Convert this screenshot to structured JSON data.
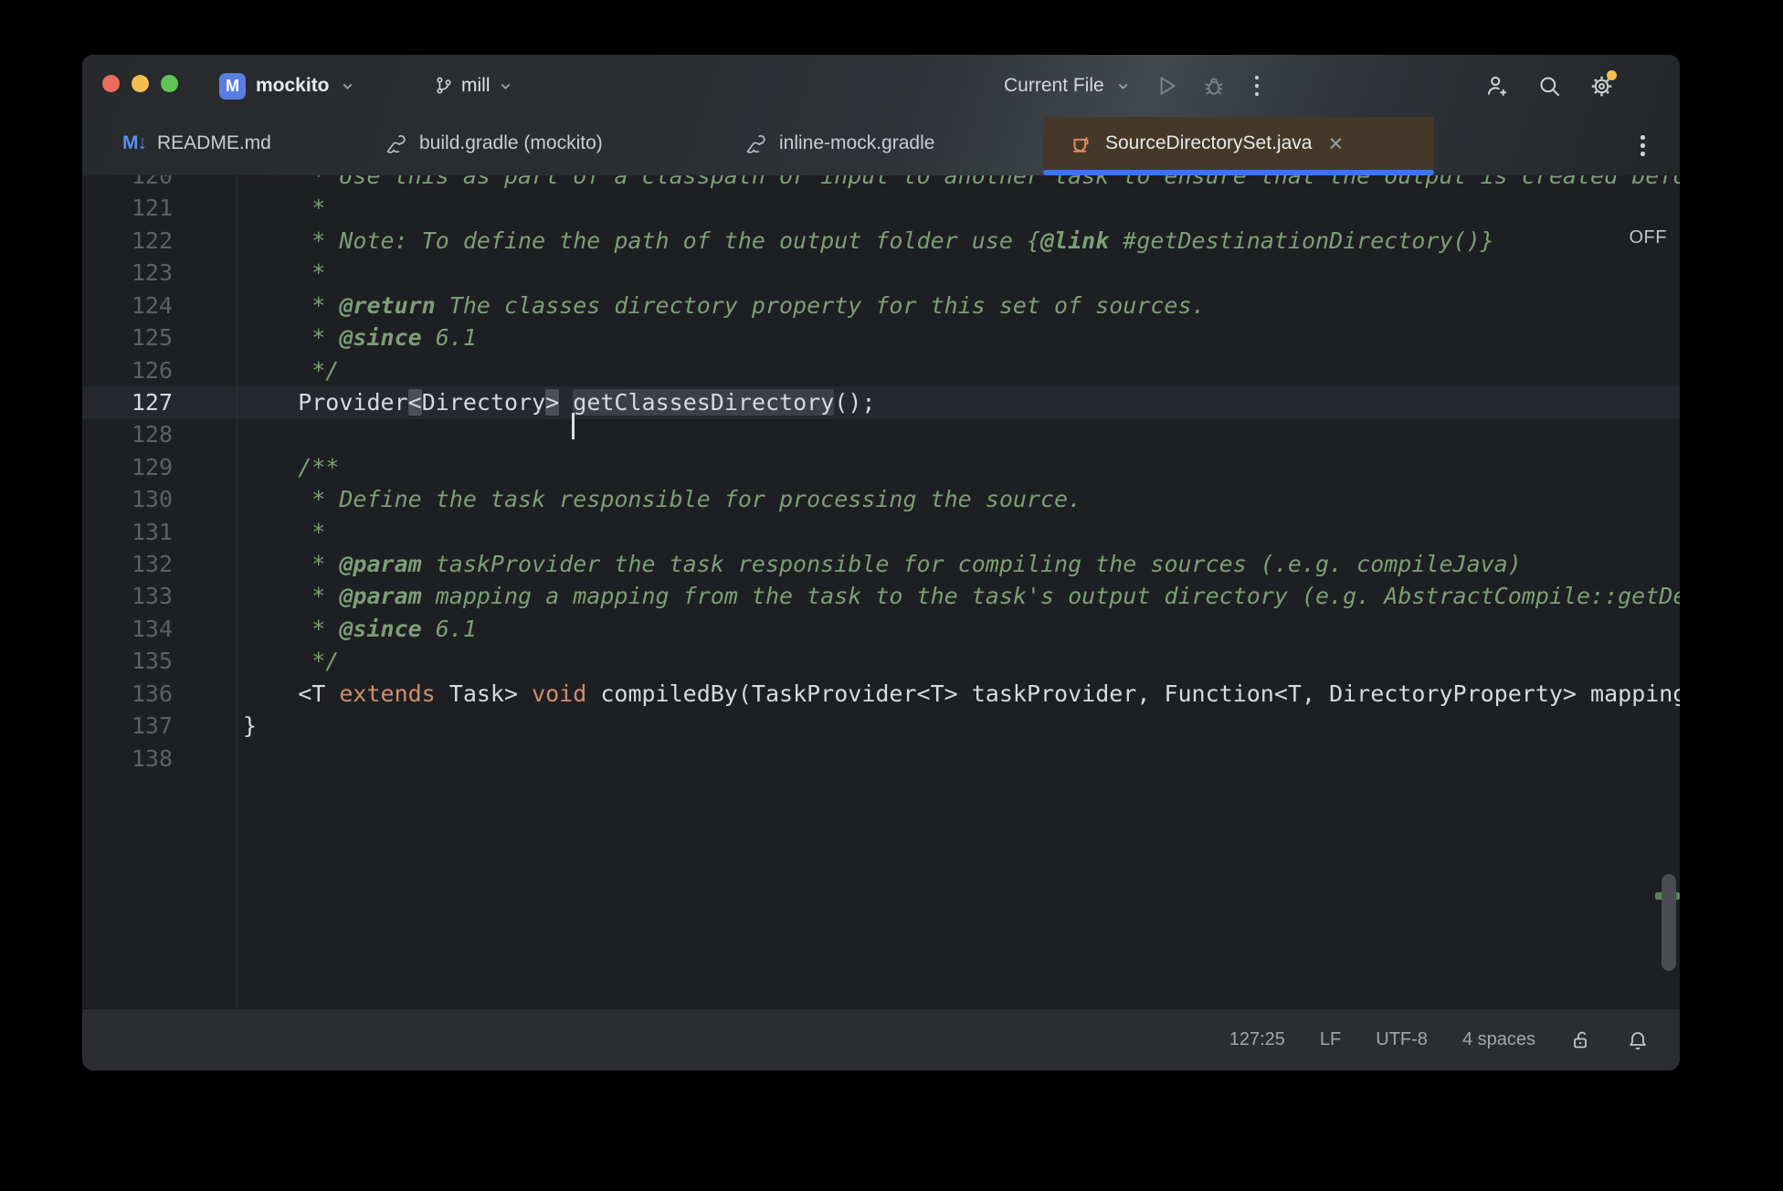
{
  "titlebar": {
    "project_icon_letter": "M",
    "project_name": "mockito",
    "branch_name": "mill",
    "run_config": "Current File"
  },
  "tabs": [
    {
      "label": "README.md",
      "icon": "markdown"
    },
    {
      "label": "build.gradle (mockito)",
      "icon": "gradle"
    },
    {
      "label": "inline-mock.gradle",
      "icon": "gradle"
    },
    {
      "label": "SourceDirectorySet.java",
      "icon": "java",
      "close_glyph": "×",
      "active": true
    }
  ],
  "markdown_glyph": "M↓",
  "editor": {
    "highlighting_widget": "OFF",
    "first_line": 120,
    "active_line": 127,
    "lines": [
      {
        "num": 120,
        "seg": [
          {
            "t": "     * Use this as part of a classpath or input to another task to ensure that the output is created before it is used.",
            "c": "cm"
          }
        ]
      },
      {
        "num": 121,
        "seg": [
          {
            "t": "     *",
            "c": "cm"
          }
        ]
      },
      {
        "num": 122,
        "seg": [
          {
            "t": "     * Note: To define the path of the output folder use {",
            "c": "cm"
          },
          {
            "t": "@link",
            "c": "cmb"
          },
          {
            "t": " #getDestinationDirectory()}",
            "c": "cm"
          }
        ]
      },
      {
        "num": 123,
        "seg": [
          {
            "t": "     *",
            "c": "cm"
          }
        ]
      },
      {
        "num": 124,
        "seg": [
          {
            "t": "     * ",
            "c": "cm"
          },
          {
            "t": "@return",
            "c": "cmb"
          },
          {
            "t": " The classes directory property for this set of sources.",
            "c": "cm"
          }
        ]
      },
      {
        "num": 125,
        "seg": [
          {
            "t": "     * ",
            "c": "cm"
          },
          {
            "t": "@since",
            "c": "cmb"
          },
          {
            "t": " 6.1",
            "c": "cm"
          }
        ]
      },
      {
        "num": 126,
        "seg": [
          {
            "t": "     */",
            "c": "cm"
          }
        ]
      },
      {
        "num": 127,
        "seg": [
          {
            "t": "    Provider",
            "c": "def"
          },
          {
            "t": "<",
            "c": "box"
          },
          {
            "t": "Directory",
            "c": "def"
          },
          {
            "t": ">",
            "c": "box"
          },
          {
            "t": " ",
            "c": "def"
          },
          {
            "t": "",
            "c": "caret"
          },
          {
            "t": "getClassesDirectory",
            "c": "idhl"
          },
          {
            "t": "();",
            "c": "def"
          }
        ]
      },
      {
        "num": 128,
        "seg": []
      },
      {
        "num": 129,
        "seg": [
          {
            "t": "    /**",
            "c": "cm"
          }
        ]
      },
      {
        "num": 130,
        "seg": [
          {
            "t": "     * Define the task responsible for processing the source.",
            "c": "cm"
          }
        ]
      },
      {
        "num": 131,
        "seg": [
          {
            "t": "     *",
            "c": "cm"
          }
        ]
      },
      {
        "num": 132,
        "seg": [
          {
            "t": "     * ",
            "c": "cm"
          },
          {
            "t": "@param",
            "c": "cmb"
          },
          {
            "t": " taskProvider the task responsible for compiling the sources (.e.g. compileJava)",
            "c": "cm"
          }
        ]
      },
      {
        "num": 133,
        "seg": [
          {
            "t": "     * ",
            "c": "cm"
          },
          {
            "t": "@param",
            "c": "cmb"
          },
          {
            "t": " mapping a mapping from the task to the task's output directory (e.g. AbstractCompile::getDestinationDirectory)",
            "c": "cm"
          }
        ]
      },
      {
        "num": 134,
        "seg": [
          {
            "t": "     * ",
            "c": "cm"
          },
          {
            "t": "@since",
            "c": "cmb"
          },
          {
            "t": " 6.1",
            "c": "cm"
          }
        ]
      },
      {
        "num": 135,
        "seg": [
          {
            "t": "     */",
            "c": "cm"
          }
        ]
      },
      {
        "num": 136,
        "seg": [
          {
            "t": "    <T ",
            "c": "def"
          },
          {
            "t": "extends",
            "c": "kw"
          },
          {
            "t": " Task> ",
            "c": "def"
          },
          {
            "t": "void",
            "c": "kw"
          },
          {
            "t": " compiledBy(TaskProvider<T> taskProvider, Function<T, DirectoryProperty> mapping);",
            "c": "def"
          }
        ]
      },
      {
        "num": 137,
        "seg": [
          {
            "t": "}",
            "c": "def"
          }
        ]
      },
      {
        "num": 138,
        "seg": []
      }
    ]
  },
  "statusbar": {
    "caret_position": "127:25",
    "line_separator": "LF",
    "encoding": "UTF-8",
    "indent": "4 spaces"
  },
  "colors": {
    "accent_blue": "#3b76ef",
    "active_tab_bg": "#453829",
    "keyword_orange": "#cf8e6d",
    "comment_green": "#7d9e77",
    "editor_bg": "#1e1f22",
    "settings_badge": "#f2c14e"
  }
}
